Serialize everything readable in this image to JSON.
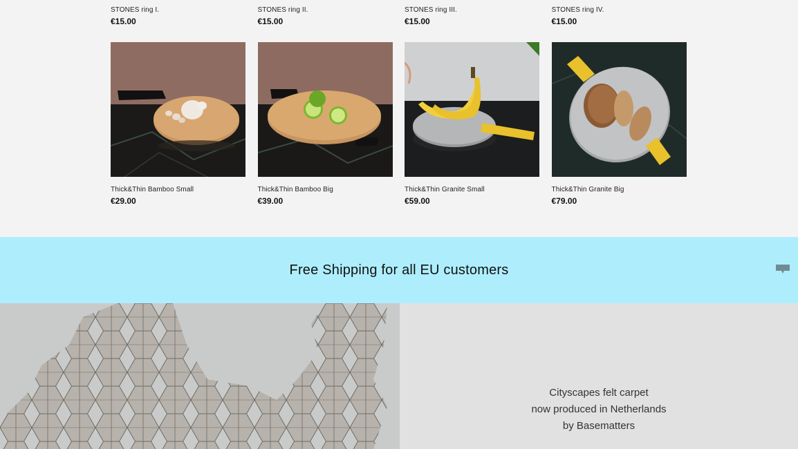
{
  "products_row1": [
    {
      "name": "STONES ring I.",
      "price": "€15.00"
    },
    {
      "name": "STONES ring II.",
      "price": "€15.00"
    },
    {
      "name": "STONES ring III.",
      "price": "€15.00"
    },
    {
      "name": "STONES ring IV.",
      "price": "€15.00"
    }
  ],
  "products_row2": [
    {
      "name": "Thick&Thin Bamboo Small",
      "price": "€29.00",
      "image": "bamboo board with garlic"
    },
    {
      "name": "Thick&Thin Bamboo Big",
      "price": "€39.00",
      "image": "bamboo board with limes"
    },
    {
      "name": "Thick&Thin Granite Small",
      "price": "€59.00",
      "image": "granite board with bananas"
    },
    {
      "name": "Thick&Thin Granite Big",
      "price": "€79.00",
      "image": "granite board with bread"
    }
  ],
  "banner": {
    "text": "Free Shipping for all EU customers",
    "color": "#aeeefc"
  },
  "promo": {
    "line1": "Cityscapes felt carpet",
    "line2": "now produced in Netherlands",
    "line3": "by Basematters"
  },
  "icons": {
    "chat": "chat-bubble-icon"
  }
}
